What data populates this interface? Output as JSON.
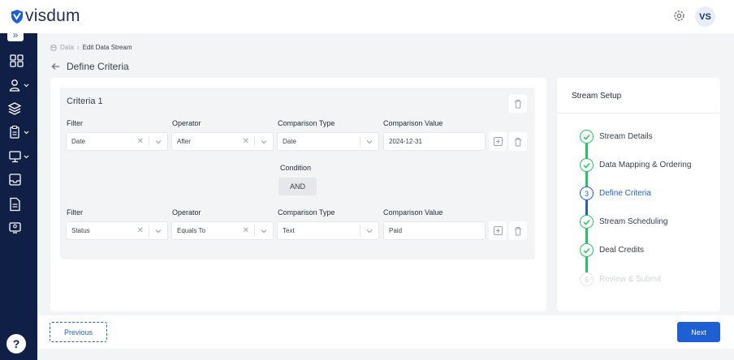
{
  "app": {
    "logo_text": "visdum",
    "user_initials": "VS"
  },
  "colors": {
    "navy": "#0f1f45",
    "primary": "#1f5fd4",
    "success": "#22c55e",
    "muted": "#d1d5db"
  },
  "sidebar": {
    "items": [
      {
        "icon": "expand-icon"
      },
      {
        "icon": "grid-icon"
      },
      {
        "icon": "user-icon"
      },
      {
        "icon": "layers-icon"
      },
      {
        "icon": "clipboard-icon"
      },
      {
        "icon": "monitor-icon"
      },
      {
        "icon": "inbox-icon"
      },
      {
        "icon": "document-icon"
      },
      {
        "icon": "id-card-icon"
      }
    ],
    "help_label": "?"
  },
  "breadcrumb": {
    "root": "Data",
    "current": "Edit Data Stream"
  },
  "page": {
    "title": "Define Criteria"
  },
  "criteria": {
    "title": "Criteria 1",
    "labels": {
      "filter": "Filter",
      "operator": "Operator",
      "comparison_type": "Comparison Type",
      "comparison_value": "Comparison Value"
    },
    "rows": [
      {
        "filter": "Date",
        "operator": "After",
        "comparison_type": "Date",
        "comparison_value": "2024-12-31"
      },
      {
        "filter": "Status",
        "operator": "Equals To",
        "comparison_type": "Text",
        "comparison_value": "Paid"
      }
    ],
    "condition_label": "Condition",
    "condition_value": "AND"
  },
  "setup": {
    "title": "Stream Setup",
    "steps": [
      {
        "label": "Stream Details",
        "state": "done"
      },
      {
        "label": "Data Mapping & Ordering",
        "state": "done"
      },
      {
        "label": "Define Criteria",
        "state": "active",
        "number": "3"
      },
      {
        "label": "Stream Scheduling",
        "state": "done"
      },
      {
        "label": "Deal Credits",
        "state": "done"
      },
      {
        "label": "Review & Submit",
        "state": "pending",
        "number": "6"
      }
    ]
  },
  "footer": {
    "previous": "Previous",
    "next": "Next"
  }
}
